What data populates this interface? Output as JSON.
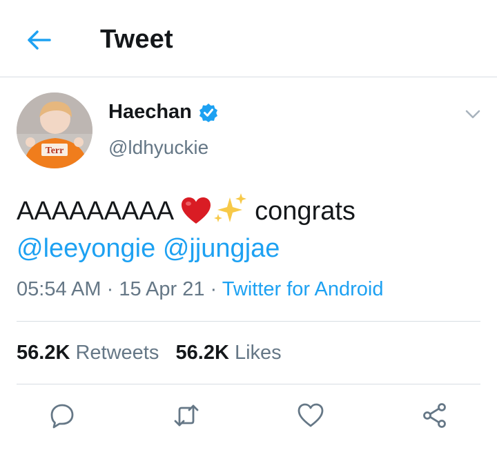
{
  "header": {
    "title": "Tweet",
    "back_icon": "back-arrow-icon"
  },
  "colors": {
    "accent": "#1da1f2",
    "secondary_text": "#657786",
    "primary_text": "#14171a",
    "divider": "#d7dde2",
    "heart": "#d91c24"
  },
  "tweet": {
    "author": {
      "name": "Haechan",
      "handle": "@ldhyuckie",
      "verified": true
    },
    "text_prefix": "AAAAAAAAA",
    "emojis": [
      "heart-emoji",
      "sparkles-emoji"
    ],
    "text_suffix": "congrats",
    "mentions": [
      "@leeyongie",
      "@jjungjae"
    ],
    "time": "05:54 AM",
    "date": "15 Apr 21",
    "source": "Twitter for Android",
    "sep": "·"
  },
  "stats": {
    "retweets_count": "56.2K",
    "retweets_label": "Retweets",
    "likes_count": "56.2K",
    "likes_label": "Likes"
  },
  "actions": [
    "reply-icon",
    "retweet-icon",
    "like-icon",
    "share-icon"
  ]
}
